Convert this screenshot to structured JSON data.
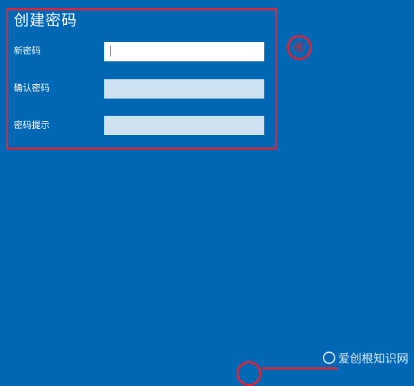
{
  "page": {
    "title": "创建密码"
  },
  "form": {
    "new_password": {
      "label": "新密码",
      "value": "",
      "placeholder": ""
    },
    "confirm_password": {
      "label": "确认密码",
      "value": "",
      "placeholder": ""
    },
    "password_hint": {
      "label": "密码提示",
      "value": "",
      "placeholder": ""
    }
  },
  "annotations": {
    "step_badge": "⑥",
    "highlight_color": "#e8202f"
  },
  "watermark": {
    "text": "爱创根知识网"
  },
  "colors": {
    "background": "#0067b4",
    "input_active": "#ffffff",
    "input_inactive": "#cde1f0"
  }
}
